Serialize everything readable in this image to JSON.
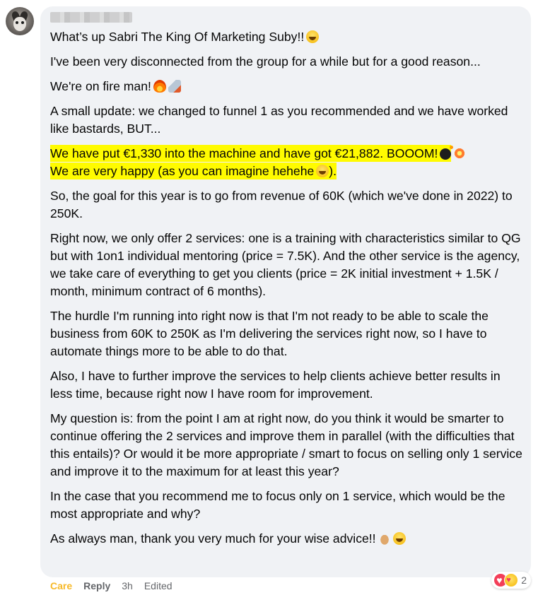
{
  "comment": {
    "paragraphs": [
      "What’s up Sabri The King Of Marketing Suby!!",
      "I've been very disconnected from the group for a while but for a good reason...",
      "We're on fire man!",
      "A small update: we changed to funnel 1 as you recommended and we have worked like bastards, BUT...",
      "We have put €1,330 into the machine and have got €21,882. BOOOM!",
      "We are very happy (as you can imagine hehehe",
      ").",
      "So, the goal for this year is to go from revenue of 60K (which we've done in 2022) to 250K.",
      "Right now, we only offer 2 services: one is a training with characteristics similar to QG but with 1on1 individual mentoring (price = 7.5K). And the other service is the agency, we take care of everything to get you clients (price = 2K initial investment + 1.5K / month, minimum contract of 6 months).",
      "The hurdle I'm running into right now is that I'm not ready to be able to scale the business from 60K to 250K as I'm delivering the services right now, so I have to automate things more to be able to do that.",
      "Also, I have to further improve the services to help clients achieve better results in less time, because right now I have room for improvement.",
      "My question is: from the point I am at right now, do you think it would be smarter to continue offering the 2 services and improve them in parallel (with the difficulties that this entails)? Or would it be more appropriate / smart to focus on selling only 1 service and improve it to the maximum for at least this year?",
      "In the case that you recommend me to focus only on 1 service, which would be the most appropriate and why?",
      "As always man, thank you very much for your wise advice!!"
    ],
    "highlight_color": "#fffb00"
  },
  "footer": {
    "care_label": "Care",
    "reply_label": "Reply",
    "time": "3h",
    "edited": "Edited"
  },
  "reactions": {
    "count": "2",
    "types": [
      "love-icon",
      "care-icon"
    ]
  },
  "icons": [
    "grin-emoji",
    "fire-emoji",
    "rocket-emoji",
    "bomb-emoji",
    "collision-emoji",
    "smile-emoji",
    "pray-emoji"
  ]
}
